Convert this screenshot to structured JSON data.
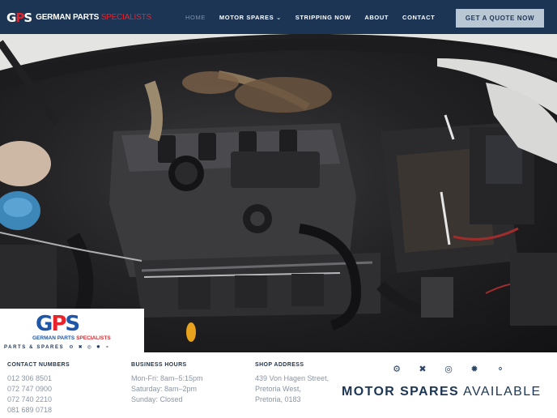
{
  "nav": {
    "logo_mark": {
      "g": "G",
      "p": "P",
      "s": "S"
    },
    "logo_text_main": "GERMAN PARTS",
    "logo_text_accent": "SPECIALISTS",
    "items": [
      {
        "label": "HOME",
        "active": true
      },
      {
        "label": "MOTOR SPARES",
        "has_dropdown": true
      },
      {
        "label": "STRIPPING NOW"
      },
      {
        "label": "ABOUT"
      },
      {
        "label": "CONTACT"
      }
    ],
    "cta_label": "GET A QUOTE NOW",
    "caret_icon": "chevron-down-icon"
  },
  "hero": {
    "image_subject": "car engine bay photo"
  },
  "badge": {
    "mark": {
      "g": "G",
      "p": "P",
      "s": "S"
    },
    "name_main": "GERMAN PARTS",
    "name_accent": "SPECIALISTS",
    "sub": "PARTS & SPARES",
    "icons": [
      "engine-icon",
      "tools-icon",
      "brake-disc-icon",
      "wheel-icon",
      "spark-plug-icon"
    ]
  },
  "footer": {
    "contact": {
      "title": "CONTACT NUMBERS",
      "lines": [
        "012 306 8501",
        "072 747 0900",
        "072 740 2210",
        "081 689 0718"
      ]
    },
    "hours": {
      "title": "BUSINESS HOURS",
      "lines": [
        "Mon-Fri: 8am–5:15pm",
        "Saturday: 8am–2pm",
        "Sunday: Closed"
      ]
    },
    "address": {
      "title": "SHOP ADDRESS",
      "lines": [
        "439 Von Hagen Street,",
        "Pretoria West,",
        "Pretoria, 0183"
      ]
    },
    "icons": [
      "engine-icon",
      "tools-icon",
      "brake-disc-icon",
      "wheel-icon",
      "spark-plug-icon"
    ],
    "tagline_bold": "MOTOR SPARES",
    "tagline_light": "AVAILABLE"
  },
  "colors": {
    "nav_bg": "#1d3554",
    "brand_red": "#e8232a",
    "brand_blue": "#1e57a8",
    "cta_bg": "#b9c7d4",
    "muted_text": "#8a96a3"
  }
}
